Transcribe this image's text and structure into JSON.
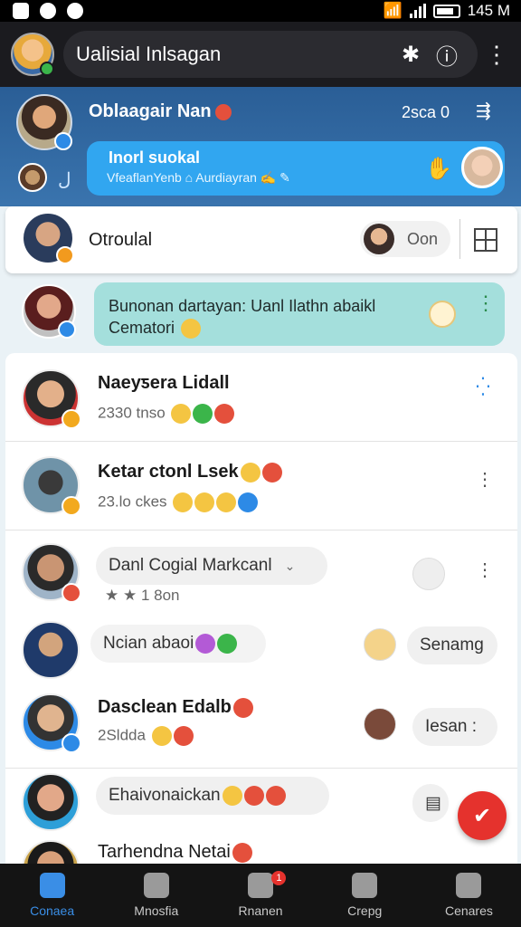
{
  "status_bar": {
    "time": "145 M"
  },
  "top_bar": {
    "title": "Ualisial Inlsagan"
  },
  "profile_header": {
    "name": "Oblaagair Nan",
    "meta": "2sca 0",
    "small_text": "ل",
    "bubble_title": "Inorl suokal",
    "bubble_sub_a": "VfeaflanYenb",
    "bubble_sub_b": "Aurdiayran"
  },
  "pinned_card": {
    "name": "Otroulal",
    "chip_label": "Oon"
  },
  "teal_message": {
    "line1": "Bunonan dartayan: Uanl Ilathn abaikl",
    "line2": "Cematori"
  },
  "chats": [
    {
      "name": "Naeyƽera Lidall",
      "sub": "2330 tnso"
    },
    {
      "name": "Ketar ctonl Lsek",
      "sub": "23.lo ckes"
    },
    {
      "name": "Danl Cogial Markcanl",
      "sub": "1 8on"
    },
    {
      "name": "Ncian abaoi",
      "chip": "Senamg"
    },
    {
      "name": "Dasclean Edalb",
      "sub": "2Sldda",
      "chip": "Iesan :"
    },
    {
      "name": "Ehaivonaickan"
    },
    {
      "name": "Tarhendna Netai"
    }
  ],
  "bottom_nav": [
    {
      "label": "Conaea",
      "active": true
    },
    {
      "label": "Mnosfia"
    },
    {
      "label": "Rnanen",
      "badge": "1"
    },
    {
      "label": "Crepg"
    },
    {
      "label": "Cenares"
    }
  ],
  "colors": {
    "header_blue": "#2a5e96",
    "bubble_blue": "#31a6f0",
    "teal": "#a4dfdc",
    "fab_red": "#e5322d",
    "nav_active": "#3a8ee6"
  }
}
